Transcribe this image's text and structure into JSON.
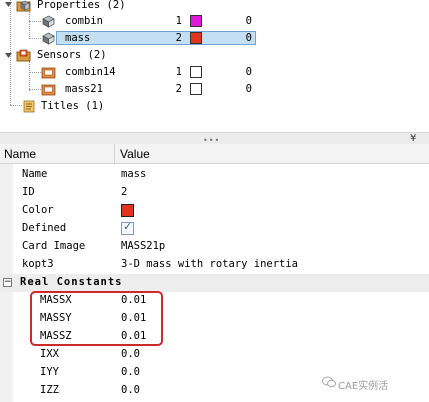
{
  "tree": {
    "items": [
      {
        "label": "Properties",
        "count": "(2)"
      },
      {
        "label": "combin",
        "num": "1",
        "swatch": "#e01bd8",
        "value": "0"
      },
      {
        "label": "mass",
        "num": "2",
        "swatch": "#e0341e",
        "value": "0"
      },
      {
        "label": "Sensors",
        "count": "(2)"
      },
      {
        "label": "combin14",
        "num": "1",
        "swatch": "#ffffff",
        "value": "0"
      },
      {
        "label": "mass21",
        "num": "2",
        "swatch": "#ffffff",
        "value": "0"
      },
      {
        "label": "Titles",
        "count": "(1)"
      }
    ]
  },
  "splitter": {
    "grip": "•••",
    "collapse": "¥"
  },
  "grid": {
    "headers": {
      "name": "Name",
      "value": "Value"
    },
    "rows": [
      {
        "name": "Name",
        "value": "mass"
      },
      {
        "name": "ID",
        "value": "2"
      },
      {
        "name": "Color",
        "value": "#e0341e"
      },
      {
        "name": "Defined",
        "value": "checked"
      },
      {
        "name": "Card Image",
        "value": "MASS21p"
      },
      {
        "name": "kopt3",
        "value": "3-D mass with rotary inertia"
      }
    ],
    "section": {
      "toggle": "−",
      "title": "Real Constants"
    },
    "constants": [
      {
        "name": "MASSX",
        "value": "0.01"
      },
      {
        "name": "MASSY",
        "value": "0.01"
      },
      {
        "name": "MASSZ",
        "value": "0.01"
      },
      {
        "name": "IXX",
        "value": "0.0"
      },
      {
        "name": "IYY",
        "value": "0.0"
      },
      {
        "name": "IZZ",
        "value": "0.0"
      }
    ]
  },
  "watermark": "CAE实例活",
  "colors": {
    "selection": "#c5dff2",
    "highlight": "#cf2a2a",
    "combin_swatch": "#e01bd8",
    "mass_swatch": "#e0341e"
  }
}
